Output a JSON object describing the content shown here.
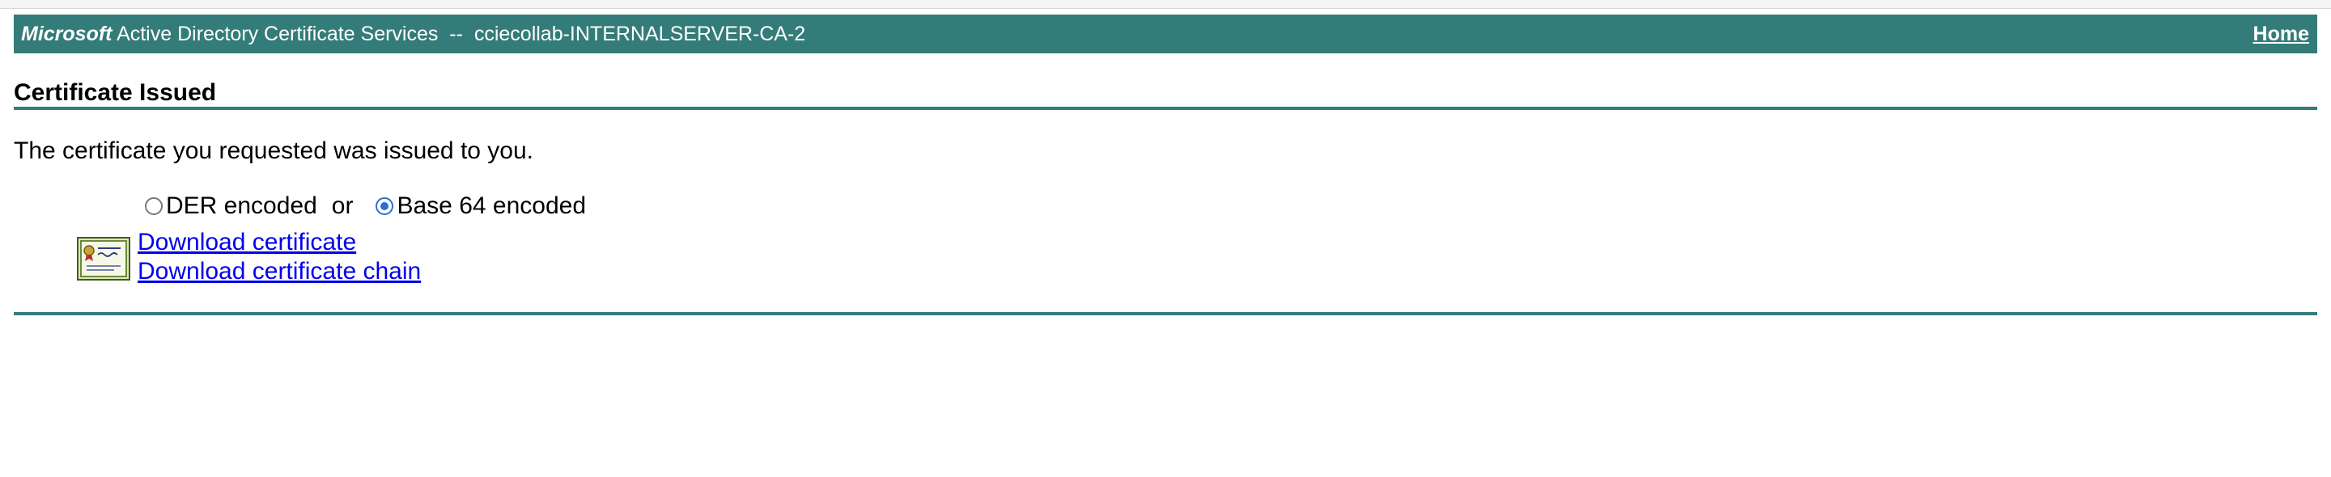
{
  "header": {
    "brand": "Microsoft",
    "service_name": " Active Directory Certificate Services  --  cciecollab-INTERNALSERVER-CA-2",
    "home_label": "Home"
  },
  "page": {
    "title": "Certificate Issued",
    "message": "The certificate you requested was issued to you."
  },
  "encoding": {
    "options": [
      {
        "label": "DER encoded",
        "selected": false
      },
      {
        "label": "Base 64 encoded",
        "selected": true
      }
    ],
    "separator": "or"
  },
  "links": {
    "download_certificate": "Download certificate",
    "download_chain": "Download certificate chain"
  },
  "icons": {
    "certificate": "certificate-icon"
  },
  "colors": {
    "banner": "#347c79",
    "link": "#0000ee",
    "radio_selected": "#2b6fd6"
  }
}
